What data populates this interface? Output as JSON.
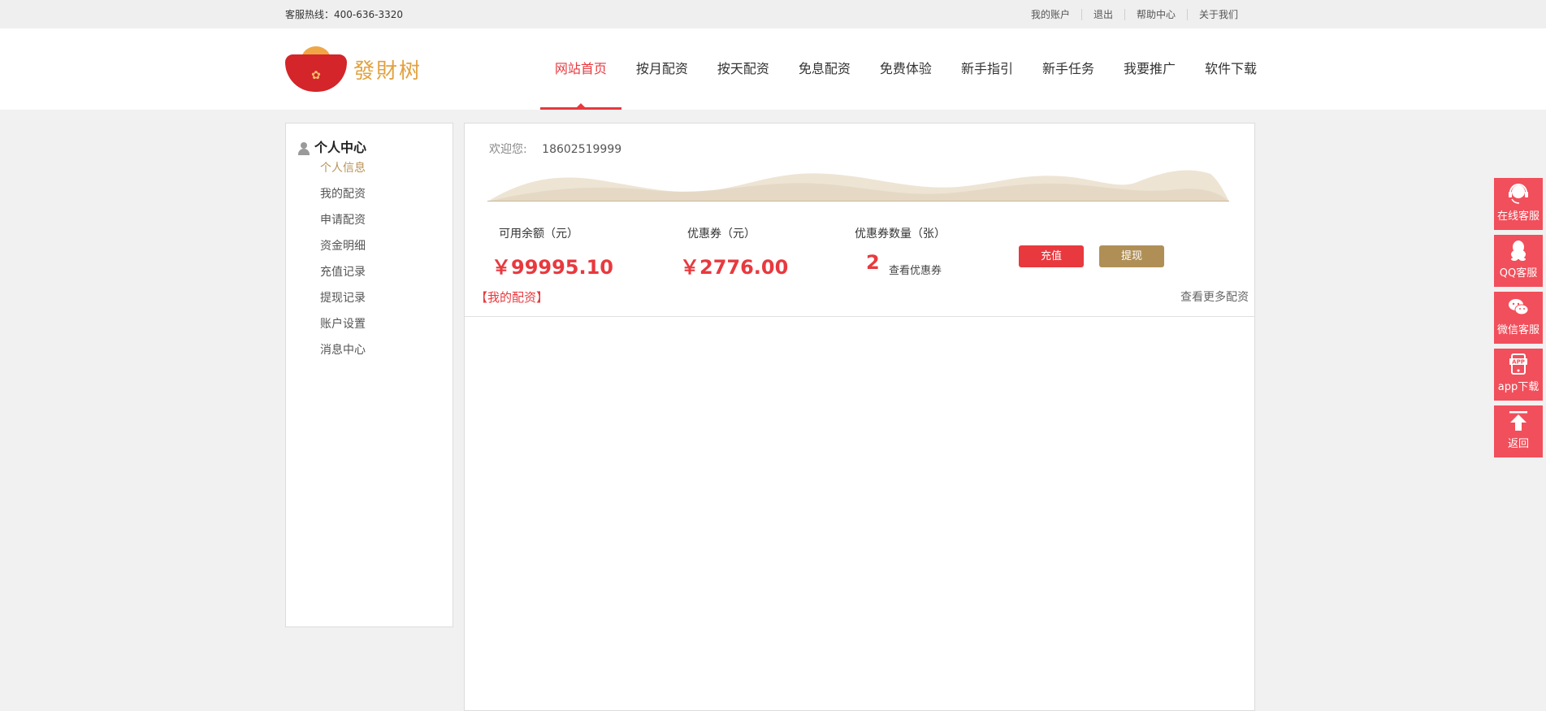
{
  "topbar": {
    "hotline": "客服热线：400-636-3320",
    "links": [
      "我的账户",
      "退出",
      "帮助中心",
      "关于我们"
    ]
  },
  "logo": {
    "brand": "發財树"
  },
  "nav": [
    "网站首页",
    "按月配资",
    "按天配资",
    "免息配资",
    "免费体验",
    "新手指引",
    "新手任务",
    "我要推广",
    "软件下载"
  ],
  "sidebar": {
    "title": "个人中心",
    "items": [
      "个人信息",
      "我的配资",
      "申请配资",
      "资金明细",
      "充值记录",
      "提现记录",
      "账户设置",
      "消息中心"
    ]
  },
  "main": {
    "welcome_label": "欢迎您:",
    "phone": "18602519999",
    "balance_label": "可用余额（元）",
    "balance_value": "￥99995.10",
    "coupon_label": "优惠券（元）",
    "coupon_value": "￥2776.00",
    "coupon_count_label": "优惠券数量（张）",
    "coupon_count": "2",
    "view_coupons": "查看优惠券",
    "recharge": "充值",
    "withdraw": "提现",
    "my_alloc": "【我的配资】",
    "more_alloc": "查看更多配资"
  },
  "float_bar": [
    {
      "label": "在线客服",
      "icon": "headset-icon"
    },
    {
      "label": "QQ客服",
      "icon": "qq-penguin-icon"
    },
    {
      "label": "微信客服",
      "icon": "wechat-icon"
    },
    {
      "label": "app下载",
      "icon": "phone-app-icon"
    },
    {
      "label": "返回",
      "icon": "arrow-up-icon"
    }
  ],
  "colors": {
    "accent_red": "#e8393e",
    "gold": "#b08f56",
    "float_red": "#f14f5b"
  }
}
